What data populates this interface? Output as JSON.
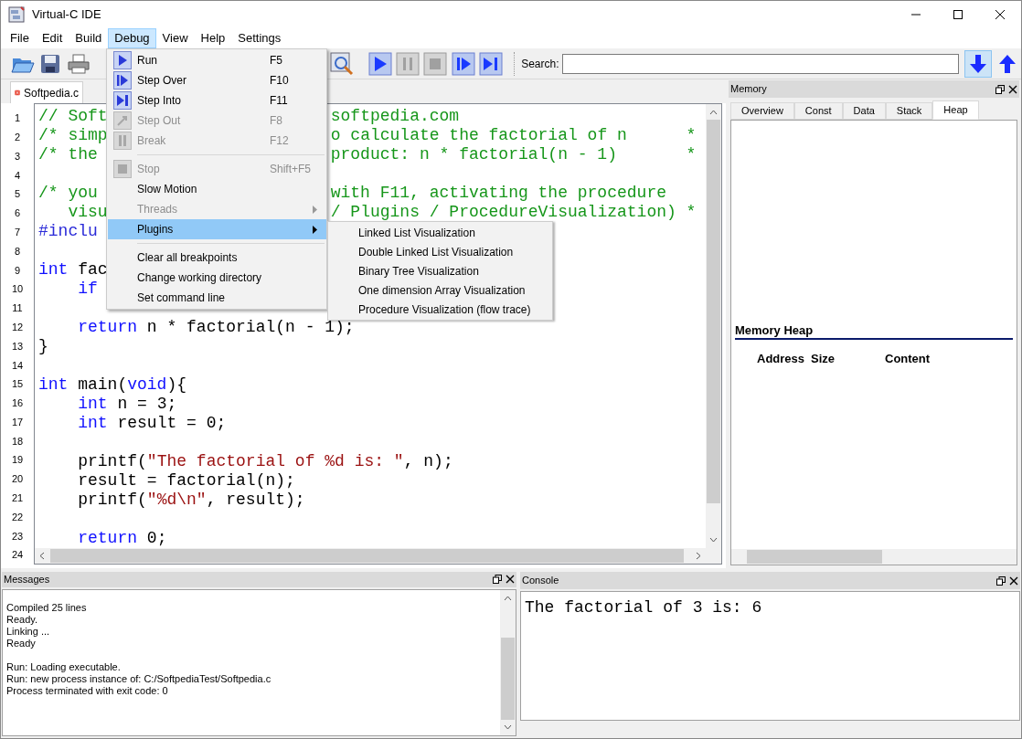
{
  "window": {
    "title": "Virtual-C IDE"
  },
  "menu_bar": [
    {
      "label": "File",
      "selected": false
    },
    {
      "label": "Edit",
      "selected": false
    },
    {
      "label": "Build",
      "selected": false
    },
    {
      "label": "Debug",
      "selected": true
    },
    {
      "label": "View",
      "selected": false
    },
    {
      "label": "Help",
      "selected": false
    },
    {
      "label": "Settings",
      "selected": false
    }
  ],
  "debug_menu": [
    {
      "kind": "item",
      "label": "Run",
      "shortcut": "F5",
      "disabled": false,
      "selected": false
    },
    {
      "kind": "item",
      "label": "Step Over",
      "shortcut": "F10",
      "disabled": false,
      "selected": false
    },
    {
      "kind": "item",
      "label": "Step Into",
      "shortcut": "F11",
      "disabled": false,
      "selected": false
    },
    {
      "kind": "item",
      "label": "Step Out",
      "shortcut": "F8",
      "disabled": true,
      "selected": false
    },
    {
      "kind": "item",
      "label": "Break",
      "shortcut": "F12",
      "disabled": true,
      "selected": false
    },
    {
      "kind": "separator"
    },
    {
      "kind": "item",
      "label": "Stop",
      "shortcut": "Shift+F5",
      "disabled": true,
      "selected": false
    },
    {
      "kind": "item",
      "label": "Slow Motion",
      "disabled": false,
      "selected": false
    },
    {
      "kind": "submenu",
      "label": "Threads",
      "disabled": true,
      "selected": false
    },
    {
      "kind": "submenu",
      "label": "Plugins",
      "disabled": false,
      "selected": true
    },
    {
      "kind": "separator"
    },
    {
      "kind": "item",
      "label": "Clear all breakpoints",
      "disabled": false,
      "selected": false
    },
    {
      "kind": "item",
      "label": "Change working directory",
      "disabled": false,
      "selected": false
    },
    {
      "kind": "item",
      "label": "Set command line",
      "disabled": false,
      "selected": false
    }
  ],
  "plugins_submenu": [
    "Linked List Visualization",
    "Double Linked List Visualization",
    "Binary Tree Visualization",
    "One dimension Array Visualization",
    "Procedure Visualization (flow trace)"
  ],
  "search": {
    "label": "Search:"
  },
  "editor": {
    "tab": "Softpedia.c",
    "lines": [
      {
        "number": "1",
        "left": [
          {
            "text": "// Soft",
            "kind": "comment"
          }
        ],
        "right": [
          {
            "text": "softpedia.com",
            "kind": "comment"
          }
        ]
      },
      {
        "number": "2",
        "left": [
          {
            "text": "/* simp",
            "kind": "comment"
          }
        ],
        "right": [
          {
            "text": "o calculate the factorial of n      *",
            "kind": "comment"
          }
        ]
      },
      {
        "number": "3",
        "left": [
          {
            "text": "/* the",
            "kind": "comment"
          }
        ],
        "right": [
          {
            "text": "product: n * factorial(n - 1)       *",
            "kind": "comment"
          }
        ]
      },
      {
        "number": "4"
      },
      {
        "number": "5",
        "left": [
          {
            "text": "/* you",
            "kind": "comment"
          }
        ],
        "right": [
          {
            "text": "with F11, activating the procedure",
            "kind": "comment"
          }
        ]
      },
      {
        "number": "6",
        "left": [
          {
            "text": "   visu",
            "kind": "comment"
          }
        ],
        "right": [
          {
            "text": "/ Plugins / ProcedureVisualization) *",
            "kind": "comment"
          }
        ]
      },
      {
        "number": "7",
        "left": [
          {
            "text": "#inclu",
            "kind": "preprocessor"
          }
        ]
      },
      {
        "number": "8"
      },
      {
        "number": "9",
        "left": [
          {
            "text": "int",
            "kind": "keyword"
          },
          {
            "text": " fac",
            "kind": "plain"
          }
        ]
      },
      {
        "number": "10",
        "left": [
          {
            "text": "    if",
            "kind": "keyword"
          }
        ]
      },
      {
        "number": "11"
      },
      {
        "number": "12",
        "left": [
          {
            "text": "    return",
            "kind": "keyword"
          },
          {
            "text": " n * factorial(n - 1);",
            "kind": "plain"
          }
        ]
      },
      {
        "number": "13",
        "left": [
          {
            "text": "}",
            "kind": "plain"
          }
        ]
      },
      {
        "number": "14"
      },
      {
        "number": "15",
        "left": [
          {
            "text": "int",
            "kind": "keyword"
          },
          {
            "text": " main(",
            "kind": "plain"
          },
          {
            "text": "void",
            "kind": "keyword"
          },
          {
            "text": "){",
            "kind": "plain"
          }
        ]
      },
      {
        "number": "16",
        "left": [
          {
            "text": "    int",
            "kind": "keyword"
          },
          {
            "text": " n = 3;",
            "kind": "plain"
          }
        ]
      },
      {
        "number": "17",
        "left": [
          {
            "text": "    int",
            "kind": "keyword"
          },
          {
            "text": " result = 0;",
            "kind": "plain"
          }
        ]
      },
      {
        "number": "18"
      },
      {
        "number": "19",
        "left": [
          {
            "text": "    printf(",
            "kind": "plain"
          },
          {
            "text": "\"The factorial of %d is: \"",
            "kind": "string"
          },
          {
            "text": ", n);",
            "kind": "plain"
          }
        ]
      },
      {
        "number": "20",
        "left": [
          {
            "text": "    result = factorial(n);",
            "kind": "plain"
          }
        ]
      },
      {
        "number": "21",
        "left": [
          {
            "text": "    printf(",
            "kind": "plain"
          },
          {
            "text": "\"%d\\n\"",
            "kind": "string"
          },
          {
            "text": ", result);",
            "kind": "plain"
          }
        ]
      },
      {
        "number": "22"
      },
      {
        "number": "23",
        "left": [
          {
            "text": "    return",
            "kind": "keyword"
          },
          {
            "text": " 0;",
            "kind": "plain"
          }
        ]
      },
      {
        "number": "24"
      }
    ]
  },
  "memory": {
    "title": "Memory",
    "tabs": [
      {
        "label": "Overview",
        "selected": false
      },
      {
        "label": "Const",
        "selected": false
      },
      {
        "label": "Data",
        "selected": false
      },
      {
        "label": "Stack",
        "selected": false
      },
      {
        "label": "Heap",
        "selected": true
      }
    ],
    "heading": "Memory Heap",
    "columns": [
      "Address",
      "Size",
      "Content"
    ]
  },
  "messages": {
    "title": "Messages",
    "groups": [
      [
        "Compiled 25 lines",
        "Ready.",
        "Linking ...",
        "Ready"
      ],
      [
        "Run: Loading executable.",
        "Run: new process instance of: C:/SoftpediaTest/Softpedia.c",
        "Process terminated with exit code: 0"
      ]
    ]
  },
  "console": {
    "title": "Console",
    "output": "The factorial of 3 is: 6"
  }
}
